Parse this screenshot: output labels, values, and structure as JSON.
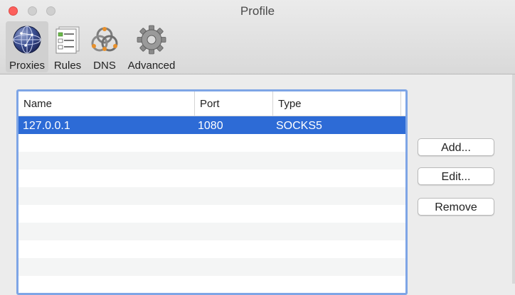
{
  "window": {
    "title": "Profile"
  },
  "toolbar": {
    "items": [
      {
        "label": "Proxies",
        "icon": "globe-icon",
        "selected": true
      },
      {
        "label": "Rules",
        "icon": "rules-checklist-icon",
        "selected": false
      },
      {
        "label": "DNS",
        "icon": "dns-network-icon",
        "selected": false
      },
      {
        "label": "Advanced",
        "icon": "gear-icon",
        "selected": false
      }
    ]
  },
  "proxies_table": {
    "columns": [
      "Name",
      "Port",
      "Type"
    ],
    "rows": [
      {
        "name": "127.0.0.1",
        "port": "1080",
        "type": "SOCKS5",
        "selected": true
      }
    ]
  },
  "actions": {
    "add_label": "Add...",
    "edit_label": "Edit...",
    "remove_label": "Remove"
  },
  "colors": {
    "selection": "#2d6bd6",
    "focus_ring": "#7ea5e6",
    "close": "#fc605c"
  }
}
